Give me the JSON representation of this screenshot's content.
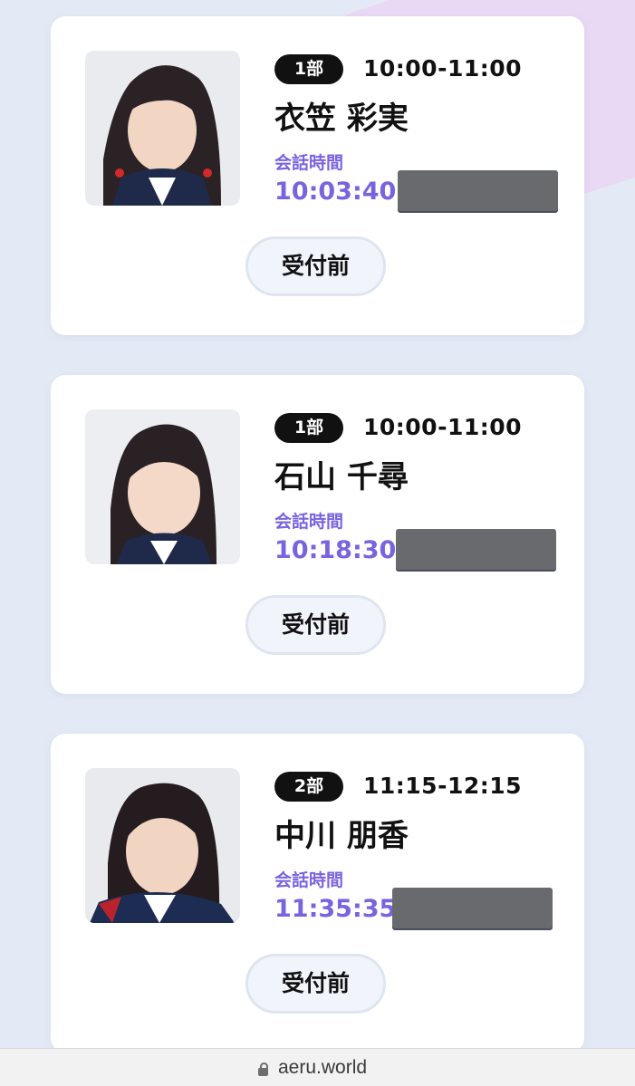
{
  "cards": [
    {
      "part": "1部",
      "time_range": "10:00-11:00",
      "name": "衣笠 彩実",
      "talk_label": "会話時間",
      "talk_time": "10:03:40",
      "status": "受付前"
    },
    {
      "part": "1部",
      "time_range": "10:00-11:00",
      "name": "石山 千尋",
      "talk_label": "会話時間",
      "talk_time": "10:18:30",
      "status": "受付前"
    },
    {
      "part": "2部",
      "time_range": "11:15-12:15",
      "name": "中川 朋香",
      "talk_label": "会話時間",
      "talk_time": "11:35:35",
      "status": "受付前"
    }
  ],
  "browser": {
    "url": "aeru.world",
    "lock_icon": "lock-icon"
  },
  "colors": {
    "accent": "#7a63de",
    "badge": "#111111",
    "background": "#e4eaf5"
  }
}
